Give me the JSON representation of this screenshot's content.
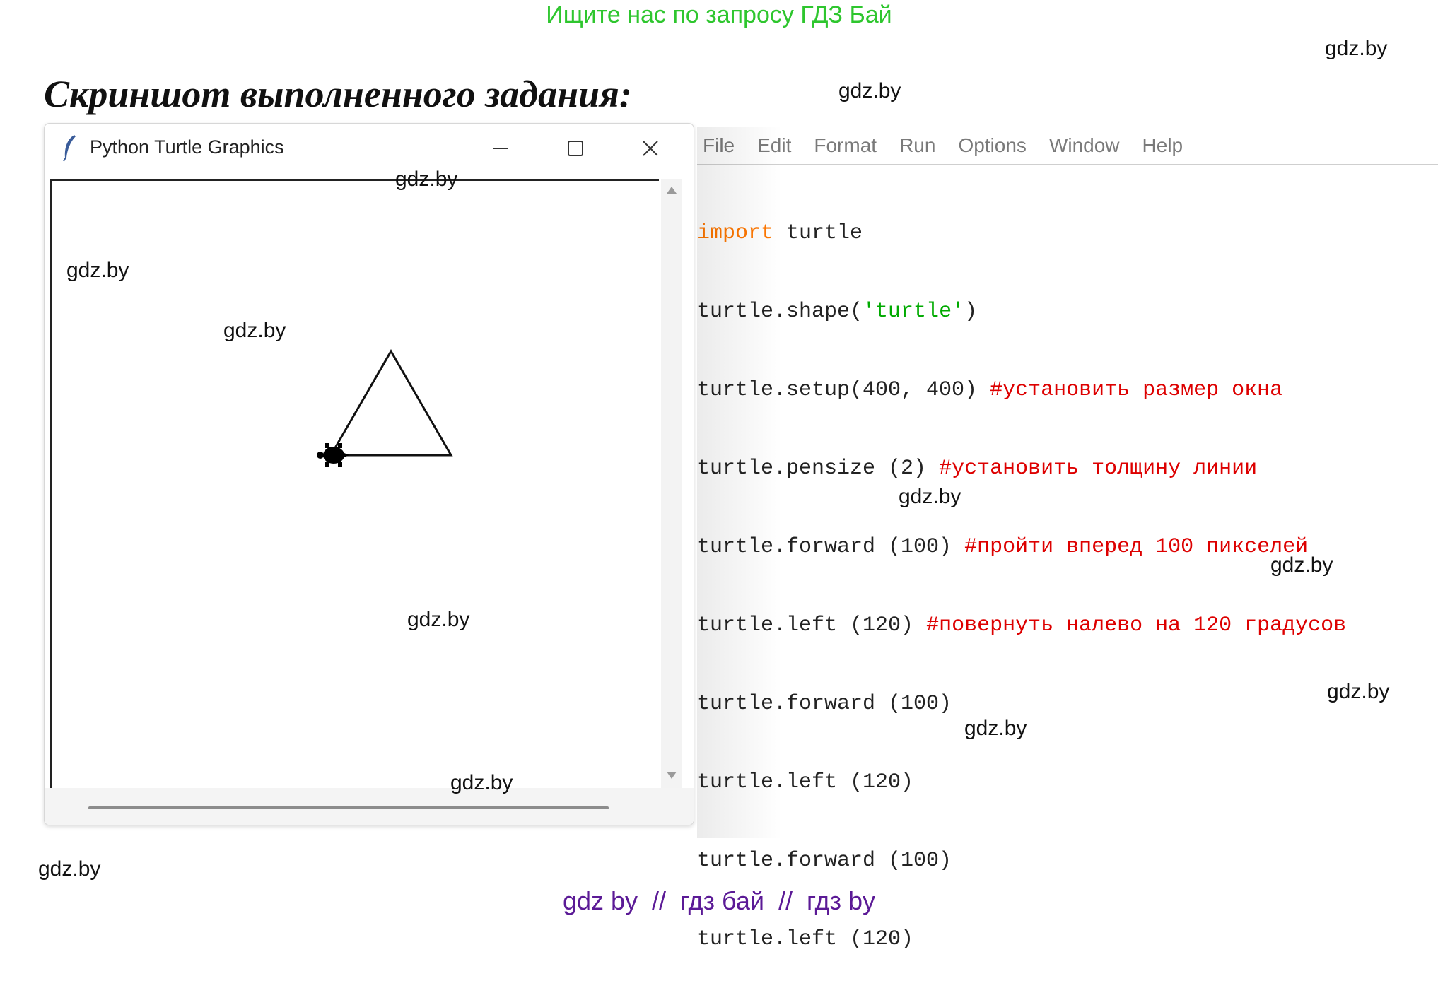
{
  "top_banner": "Ищите нас по запросу ГДЗ Бай",
  "heading": "Скриншот выполненного задания:",
  "bottom_banner": "gdz by  //  гдз бай  //  гдз by",
  "watermark": "gdz.by",
  "turtle_window": {
    "title": "Python Turtle Graphics",
    "minimize_glyph": "—",
    "close_glyph": "✕",
    "icons": [
      "feather-icon",
      "minimize-icon",
      "maximize-icon",
      "close-icon",
      "scroll-up-arrow-icon",
      "scroll-down-arrow-icon",
      "turtle-icon"
    ]
  },
  "editor": {
    "menu": [
      "File",
      "Edit",
      "Format",
      "Run",
      "Options",
      "Window",
      "Help"
    ],
    "code_lines": [
      {
        "kw": "import",
        "rest": " turtle"
      },
      {
        "pre": "turtle.shape(",
        "str": "'turtle'",
        "post": ")"
      },
      {
        "pre": "turtle.setup(400, 400) ",
        "cmt": "#установить размер окна"
      },
      {
        "pre": "turtle.pensize (2) ",
        "cmt": "#установить толщину линии"
      },
      {
        "pre": "turtle.forward (100) ",
        "cmt": "#пройти вперед 100 пикселей"
      },
      {
        "pre": "turtle.left (120) ",
        "cmt": "#повернуть налево на 120 градусов"
      },
      {
        "pre": "turtle.forward (100)"
      },
      {
        "pre": "turtle.left (120)"
      },
      {
        "pre": "turtle.forward (100)"
      },
      {
        "pre": "turtle.left (120)"
      }
    ]
  },
  "colors": {
    "top_banner": "#2ec62e",
    "bottom_banner": "#5b1a96",
    "keyword": "#ff7700",
    "string": "#00aa00",
    "comment": "#dd0000"
  }
}
